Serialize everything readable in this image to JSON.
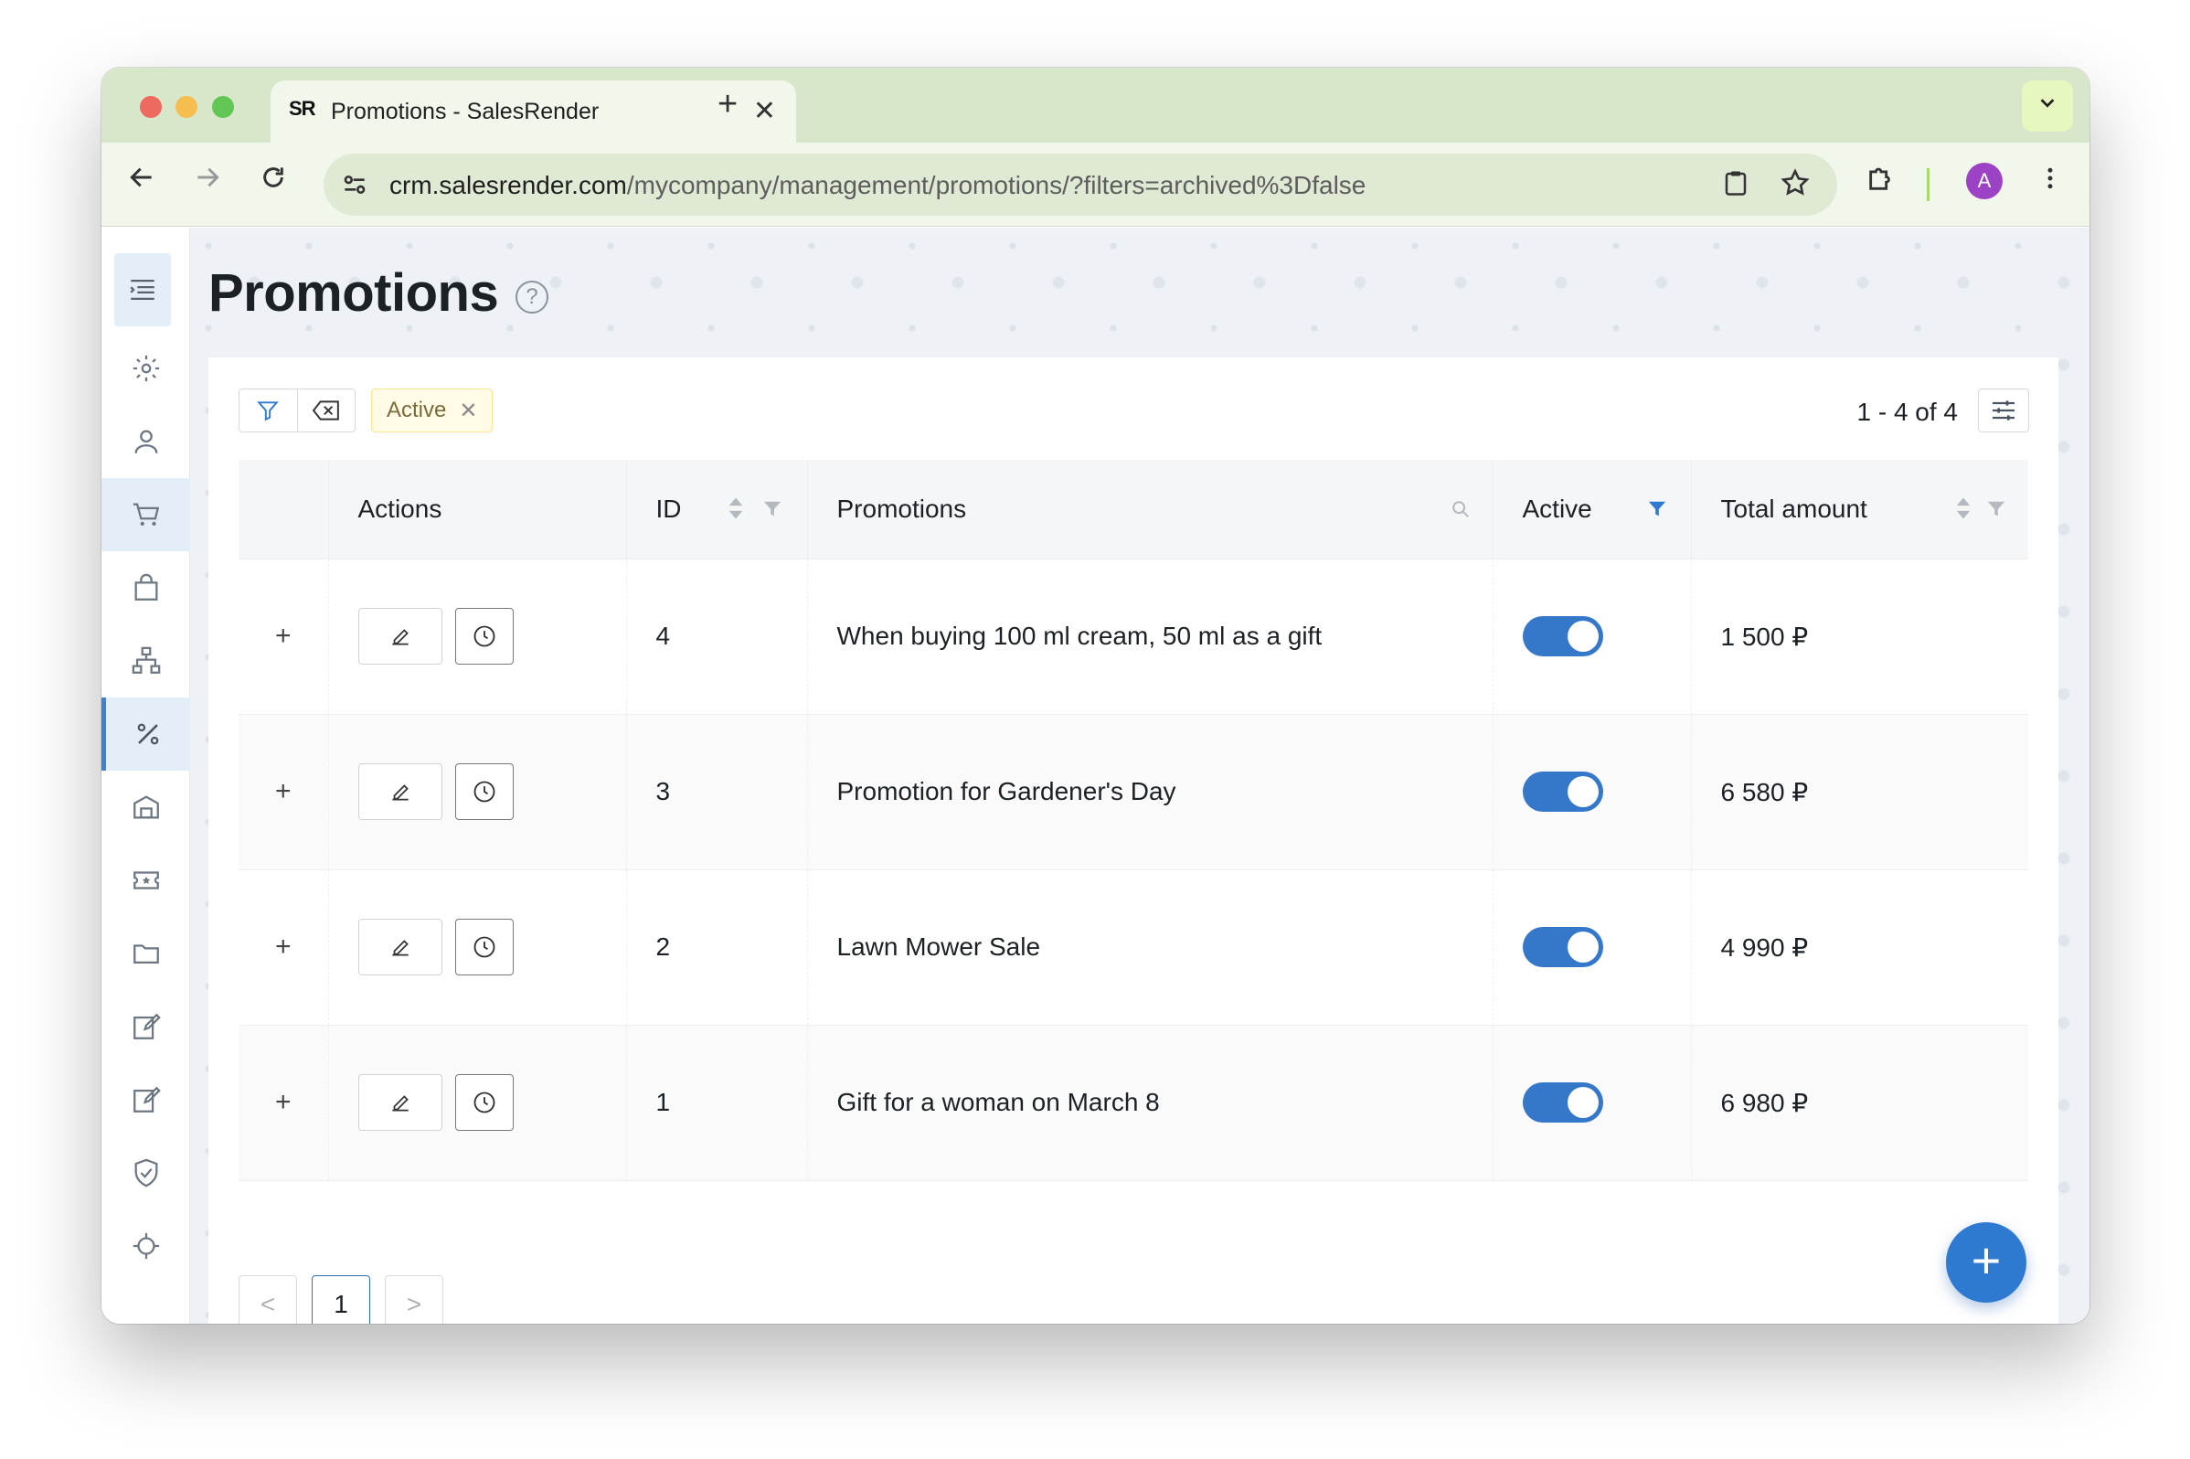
{
  "browser": {
    "tab_title": "Promotions - SalesRender",
    "favicon_text": "SR",
    "url_host": "crm.salesrender.com",
    "url_path": "/mycompany/management/promotions/?filters=archived%3Dfalse",
    "profile_initial": "A"
  },
  "page": {
    "title": "Promotions",
    "help": "?"
  },
  "filters": {
    "chip_label": "Active",
    "counter": "1 - 4 of 4"
  },
  "table": {
    "columns": [
      "Actions",
      "ID",
      "Promotions",
      "Active",
      "Total amount"
    ],
    "rows": [
      {
        "id": "4",
        "name": "When buying 100 ml cream, 50 ml as a gift",
        "active": true,
        "total": "1 500 ₽"
      },
      {
        "id": "3",
        "name": "Promotion for Gardener's Day",
        "active": true,
        "total": "6 580 ₽"
      },
      {
        "id": "2",
        "name": "Lawn Mower Sale",
        "active": true,
        "total": "4 990 ₽"
      },
      {
        "id": "1",
        "name": "Gift for a woman on March 8",
        "active": true,
        "total": "6 980 ₽"
      }
    ]
  },
  "pagination": {
    "prev": "<",
    "current": "1",
    "next": ">"
  },
  "colors": {
    "accent": "#2f7ad1",
    "toggle_on": "#3577c9",
    "tab_strip": "#d8e6c9"
  }
}
